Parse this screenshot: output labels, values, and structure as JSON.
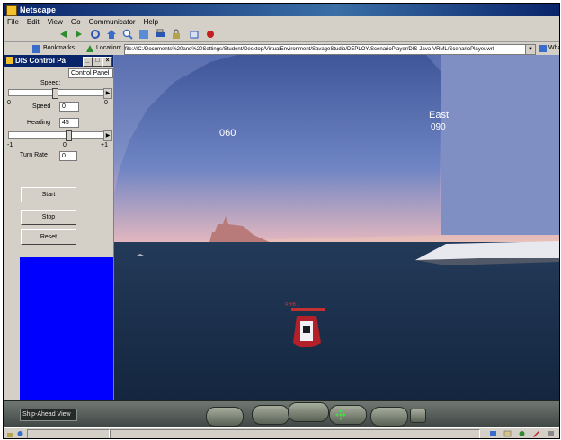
{
  "window": {
    "title": "Netscape"
  },
  "menubar": {
    "items": [
      "File",
      "Edit",
      "View",
      "Go",
      "Communicator",
      "Help"
    ]
  },
  "toolbar": {
    "bookmarks_label": "Bookmarks",
    "location_label": "Location:",
    "url": "file:///C:/Documents%20and%20Settings/Student/Desktop/VirtualEnvironment/SavageStudio/DEPLOY/ScenarioPlayer/DIS-Java-VRML/ScenarioPlayer.wrl",
    "related_label": "What's Related"
  },
  "panel": {
    "title": "DIS Control Pa",
    "control_box_value": "Control Panel",
    "speed_label": "Speed:",
    "speed_scale_left": "0",
    "speed_scale_right": "0",
    "speed_field_label": "Speed",
    "speed_value": "0",
    "heading_label": "Heading",
    "heading_value": "45",
    "heading_scale_left": "-1",
    "heading_scale_mid": "0",
    "heading_scale_right": "+1",
    "turn_rate_label": "Turn Rate",
    "turn_rate_value": "0",
    "btn_1": "Start",
    "btn_2": "Stop",
    "btn_3": "Reset"
  },
  "scene": {
    "dome_labels": [
      "060",
      "East",
      "090"
    ],
    "vessel_marker": "RHIB 1",
    "colors": {
      "sky": "#6c7fb3",
      "sea": "#1c3352",
      "dome": "#4c64a3"
    }
  },
  "navbar": {
    "viewpoint": "Ship-Ahead View"
  }
}
